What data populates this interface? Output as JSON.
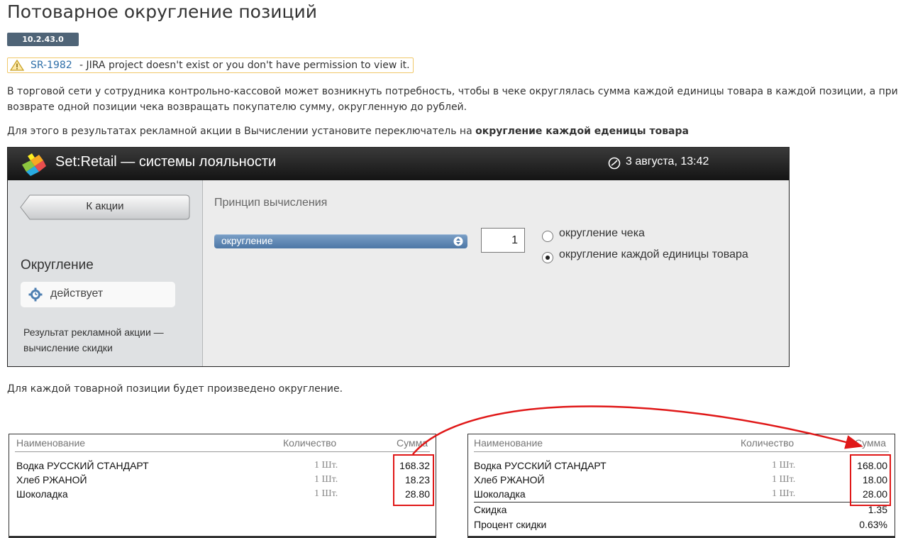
{
  "page": {
    "title": "Потоварное округление позиций",
    "version": "10.2.43.0",
    "jira": {
      "link": "SR-1982",
      "text": " - JIRA project doesn't exist or you don't have permission to view it."
    },
    "para1_line1": "В торговой сети у сотрудника контрольно-кассовой может возникнуть потребность, чтобы в чеке округлялась сумма каждой единицы товара в каждой позиции, а при",
    "para1_line2": "возврате одной позиции чека возвращать покупателю сумму, округленную до рублей.",
    "para2_text": "Для этого в результатах рекламной акции в Вычислении установите переключатель на ",
    "para2_bold": "округление каждой еденицы товара",
    "para3": "Для каждой товарной позиции будет произведено округление."
  },
  "app": {
    "title": "Set:Retail — системы лояльности",
    "datetime": "3 августа, 13:42",
    "back_button": "К акции",
    "sidebar_heading": "Округление",
    "status": "действует",
    "result_text": "Результат рекламной акции — вычисление скидки",
    "calc_label": "Принцип вычисления",
    "calc_select": "округление",
    "calc_value": "1",
    "radio_options": [
      "округление чека",
      "округление каждой единицы товара"
    ],
    "radio_selected_index": 1
  },
  "receipts": {
    "headers": {
      "name": "Наименование",
      "qty": "Количество",
      "sum": "Сумма"
    },
    "before": {
      "rows": [
        {
          "name": "Водка РУССКИЙ СТАНДАРТ",
          "qty": "1 Шт.",
          "sum": "168.32"
        },
        {
          "name": "Хлеб РЖАНОЙ",
          "qty": "1 Шт.",
          "sum": "18.23"
        },
        {
          "name": "Шоколадка",
          "qty": "1 Шт.",
          "sum": "28.80"
        }
      ]
    },
    "after": {
      "rows": [
        {
          "name": "Водка РУССКИЙ СТАНДАРТ",
          "qty": "1 Шт.",
          "sum": "168.00"
        },
        {
          "name": "Хлеб РЖАНОЙ",
          "qty": "1 Шт.",
          "sum": "18.00"
        },
        {
          "name": "Шоколадка",
          "qty": "1 Шт.",
          "sum": "28.00"
        }
      ],
      "discount_label": "Скидка",
      "discount_value": "1.35",
      "discount_percent_label": "Процент скидки",
      "discount_percent_value": "0.63%"
    }
  },
  "colors": {
    "highlight": "#e01818",
    "badge": "#4f6477",
    "select": "#5a82ae",
    "link": "#2f6fa8"
  },
  "icons": [
    "warning-icon",
    "logo-icon",
    "clock-icon",
    "gear-icon",
    "select-arrows-icon"
  ]
}
